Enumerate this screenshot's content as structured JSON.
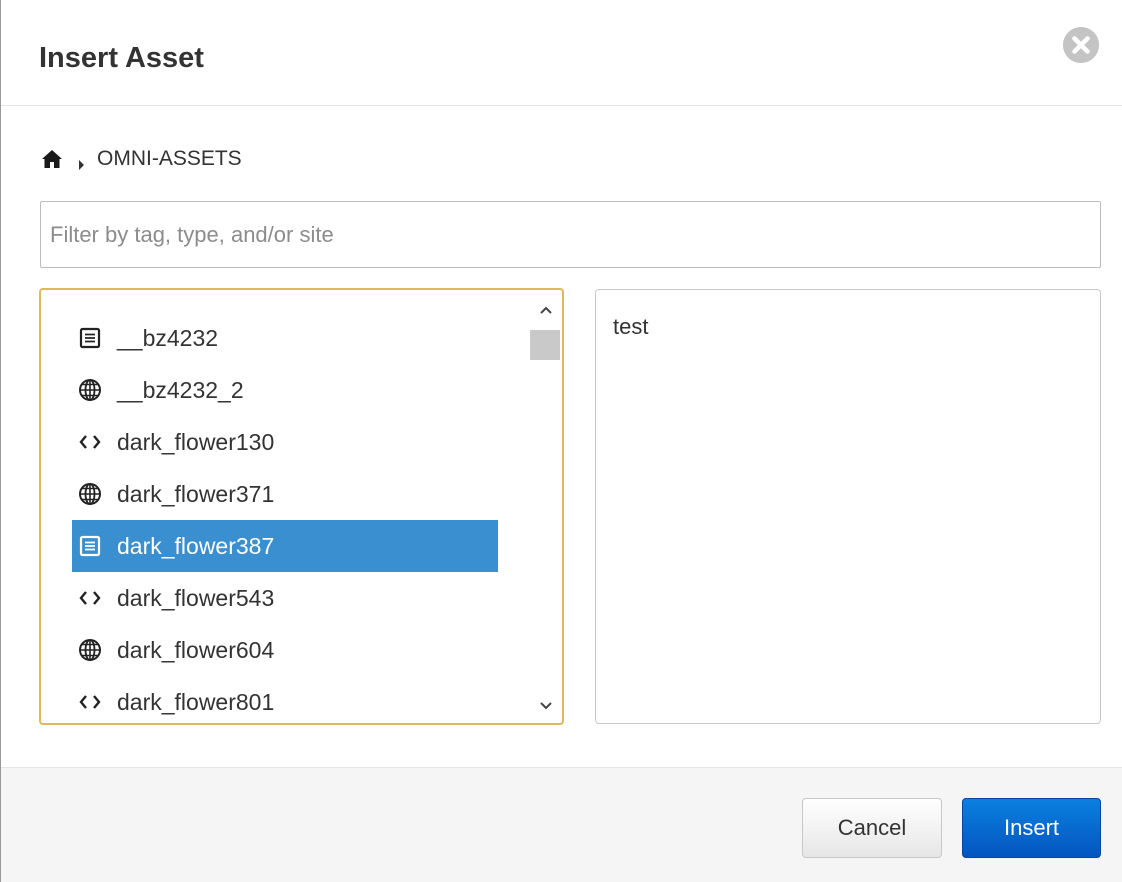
{
  "dialog": {
    "title": "Insert Asset"
  },
  "breadcrumb": {
    "items": [
      "OMNI-ASSETS"
    ]
  },
  "filter": {
    "value": "",
    "placeholder": "Filter by tag, type, and/or site"
  },
  "assets": {
    "items": [
      {
        "label": "__bz4232",
        "icon": "document-icon"
      },
      {
        "label": "__bz4232_2",
        "icon": "globe-icon"
      },
      {
        "label": "dark_flower130",
        "icon": "code-icon"
      },
      {
        "label": "dark_flower371",
        "icon": "globe-icon"
      },
      {
        "label": "dark_flower387",
        "icon": "document-icon",
        "selected": true
      },
      {
        "label": "dark_flower543",
        "icon": "code-icon"
      },
      {
        "label": "dark_flower604",
        "icon": "globe-icon"
      },
      {
        "label": "dark_flower801",
        "icon": "code-icon"
      }
    ]
  },
  "preview": {
    "text": "test"
  },
  "footer": {
    "cancel_label": "Cancel",
    "insert_label": "Insert"
  },
  "colors": {
    "selected_bg": "#3a8fd0",
    "primary_button": "#0a6fd6",
    "focus_border": "#e2b75d"
  }
}
